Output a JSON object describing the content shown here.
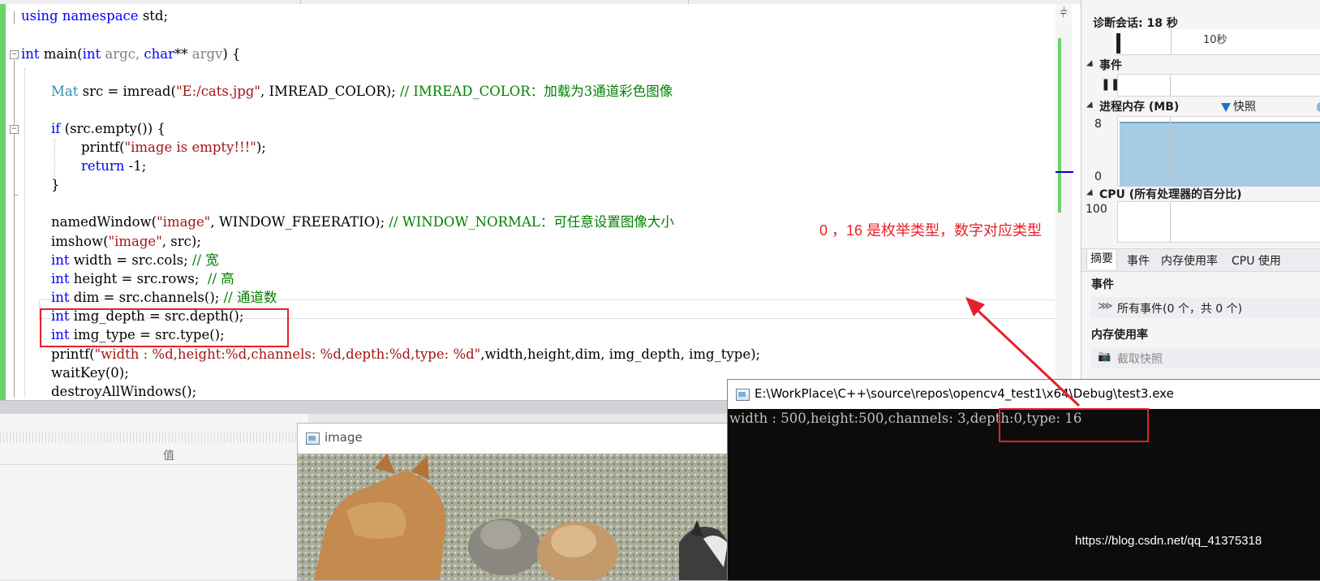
{
  "editor": {
    "lines": [
      {
        "segments": [
          {
            "t": "using namespace ",
            "c": "kw"
          },
          {
            "t": "std;",
            "c": ""
          }
        ]
      },
      {
        "segments": [
          {
            "t": "int ",
            "c": "kw"
          },
          {
            "t": "main(",
            "c": ""
          },
          {
            "t": "int ",
            "c": "kw"
          },
          {
            "t": "argc, ",
            "c": "pm"
          },
          {
            "t": "char",
            "c": "kw"
          },
          {
            "t": "** ",
            "c": ""
          },
          {
            "t": "argv",
            "c": "pm"
          },
          {
            "t": ") {",
            "c": ""
          }
        ]
      },
      {
        "segments": [
          {
            "t": "Mat ",
            "c": "ty"
          },
          {
            "t": "src = imread(",
            "c": ""
          },
          {
            "t": "\"E:/cats.jpg\"",
            "c": "st"
          },
          {
            "t": ", IMREAD_COLOR); ",
            "c": ""
          },
          {
            "t": "// IMREAD_COLOR：加载为3通道彩色图像",
            "c": "cm"
          }
        ]
      },
      {
        "segments": [
          {
            "t": "if ",
            "c": "kw"
          },
          {
            "t": "(src.empty()) {",
            "c": ""
          }
        ]
      },
      {
        "segments": [
          {
            "t": "printf(",
            "c": ""
          },
          {
            "t": "\"image is empty!!!\"",
            "c": "st"
          },
          {
            "t": ");",
            "c": ""
          }
        ]
      },
      {
        "segments": [
          {
            "t": "return ",
            "c": "kw"
          },
          {
            "t": "-1;",
            "c": ""
          }
        ]
      },
      {
        "segments": [
          {
            "t": "}",
            "c": ""
          }
        ]
      },
      {
        "segments": [
          {
            "t": "namedWindow(",
            "c": ""
          },
          {
            "t": "\"image\"",
            "c": "st"
          },
          {
            "t": ", WINDOW_FREERATIO); ",
            "c": ""
          },
          {
            "t": "// WINDOW_NORMAL：可任意设置图像大小",
            "c": "cm"
          }
        ]
      },
      {
        "segments": [
          {
            "t": "imshow(",
            "c": ""
          },
          {
            "t": "\"image\"",
            "c": "st"
          },
          {
            "t": ", src);",
            "c": ""
          }
        ]
      },
      {
        "segments": [
          {
            "t": "int ",
            "c": "kw"
          },
          {
            "t": "width = src.cols; ",
            "c": ""
          },
          {
            "t": "// 宽",
            "c": "cm"
          }
        ]
      },
      {
        "segments": [
          {
            "t": "int ",
            "c": "kw"
          },
          {
            "t": "height = src.rows;  ",
            "c": ""
          },
          {
            "t": "// 高",
            "c": "cm"
          }
        ]
      },
      {
        "segments": [
          {
            "t": "int ",
            "c": "kw"
          },
          {
            "t": "dim = src.channels(); ",
            "c": ""
          },
          {
            "t": "// 通道数",
            "c": "cm"
          }
        ]
      },
      {
        "segments": [
          {
            "t": "int ",
            "c": "kw"
          },
          {
            "t": "img_depth = src.depth();",
            "c": ""
          }
        ]
      },
      {
        "segments": [
          {
            "t": "int ",
            "c": "kw"
          },
          {
            "t": "img_type = src.type();",
            "c": ""
          }
        ]
      },
      {
        "segments": [
          {
            "t": "printf(",
            "c": ""
          },
          {
            "t": "\"width : %d,height:%d,channels: %d,depth:%d,type: %d\"",
            "c": "st"
          },
          {
            "t": ",width,height,dim, img_depth, img_type);",
            "c": ""
          }
        ]
      },
      {
        "segments": [
          {
            "t": "waitKey(0);",
            "c": ""
          }
        ]
      },
      {
        "segments": [
          {
            "t": "destroyAllWindows();",
            "c": ""
          }
        ]
      }
    ],
    "split_icon": "split-view-icon"
  },
  "annotation": {
    "text": "0 ，16 是枚举类型，数字对应类型",
    "color": "#e5202b"
  },
  "locals_panel": {
    "value_header": "值"
  },
  "image_window": {
    "title": "image",
    "icon": "window-app-icon"
  },
  "console": {
    "title": "E:\\WorkPlace\\C++\\source\\repos\\opencv4_test1\\x64\\Debug\\test3.exe",
    "output": "width : 500,height:500,channels: 3,depth:0,type: 16",
    "watermark": "https://blog.csdn.net/qq_41375318"
  },
  "diagnostics": {
    "session": "诊断会话: 18 秒",
    "timeline_tick": "10秒",
    "events_title": "事件",
    "process_memory_title": "进程内存 (MB)",
    "snapshot_label": "快照",
    "mem_max": "8",
    "mem_min": "0",
    "cpu_title": "CPU (所有处理器的百分比)",
    "cpu_max": "100",
    "tabs": [
      "摘要",
      "事件",
      "内存使用率",
      "CPU 使用"
    ],
    "events_heading": "事件",
    "all_events": "所有事件(0 个，共 0 个)",
    "memory_heading": "内存使用率",
    "take_snapshot": "截取快照",
    "accent_color": "#1a73c8",
    "memory_fill_color": "#a6cbe3"
  }
}
